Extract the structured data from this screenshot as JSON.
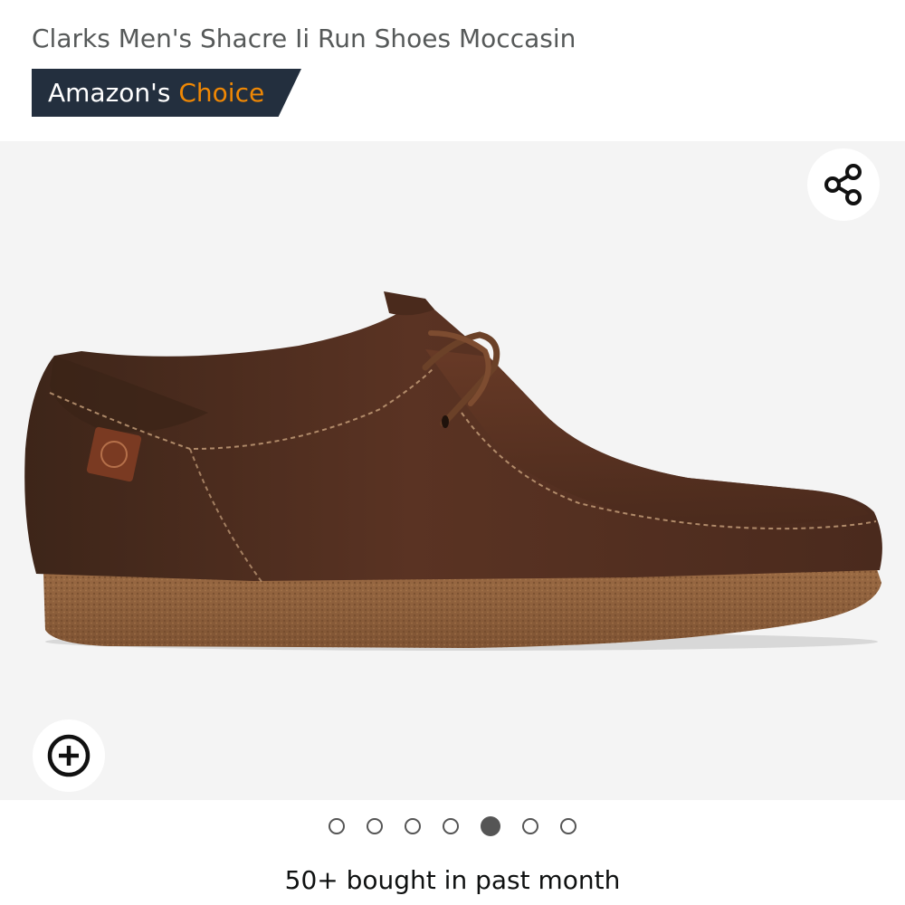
{
  "product": {
    "title": "Clarks Men's Shacre Ii Run Shoes Moccasin"
  },
  "badge": {
    "prefix": "Amazon's",
    "accent": "Choice",
    "bg_color": "#232f3e",
    "accent_color": "#f08804"
  },
  "image": {
    "subject": "brown leather moccasin shoe with crepe sole",
    "share_icon": "share-icon",
    "zoom_icon": "zoom-plus-icon"
  },
  "carousel": {
    "count": 7,
    "active_index": 4
  },
  "social_proof": {
    "text": "50+ bought in past month"
  }
}
